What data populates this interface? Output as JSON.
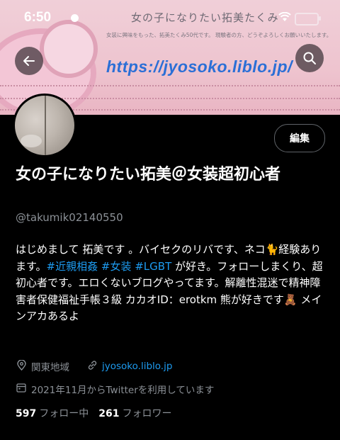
{
  "status_bar": {
    "time": "6:50"
  },
  "banner": {
    "title": "女の子になりたい拓美たくみ",
    "description": "女装に興味をもった、拓美たくみ50代です。 現験者の方、どうぞよろしくお願いいたします。",
    "url": "https://jyosoko.liblo.jp/"
  },
  "header": {
    "back_icon": "arrow-left-icon",
    "search_icon": "search-icon"
  },
  "profile": {
    "edit_label": "編集",
    "name": "女の子になりたい拓美＠女装超初心者",
    "handle": "@takumik02140550",
    "bio_pre": "はじめまして 拓美です 。バイセクのリバです、ネコ🐈経験あります。",
    "bio_tags": [
      "#近親相姦",
      "#女装",
      "#LGBT"
    ],
    "bio_post": " が好き。フォローしまくり、超初心者です。エロくないブログやってます。解離性混迷で精神障害者保健福祉手帳３級 カカオID：erotkm 熊が好きです🧸 メインアカあるよ",
    "location": "関東地域",
    "website": "jyosoko.liblo.jp",
    "joined": "2021年11月からTwitterを利用しています",
    "following_count": "597",
    "following_label": "フォロー中",
    "followers_count": "261",
    "followers_label": "フォロワー"
  }
}
